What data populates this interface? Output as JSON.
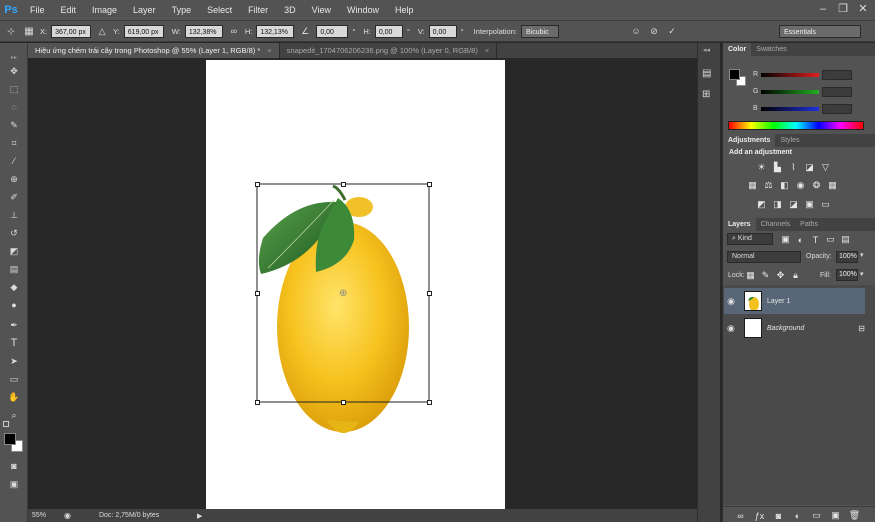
{
  "app": {
    "logo": "Ps"
  },
  "menu": [
    "File",
    "Edit",
    "Image",
    "Layer",
    "Type",
    "Select",
    "Filter",
    "3D",
    "View",
    "Window",
    "Help"
  ],
  "window_controls": {
    "minimize": "–",
    "restore": "❐",
    "close": "✕"
  },
  "options": {
    "x_label": "X:",
    "x_value": "367,00 px",
    "y_label": "Y:",
    "y_value": "619,00 px",
    "w_label": "W:",
    "w_value": "132,38%",
    "h_label": "H:",
    "h_value": "132,13%",
    "angle_value": "0,00",
    "degree": "°",
    "hskew_label": "H:",
    "hskew_value": "0,00",
    "vskew_label": "V:",
    "vskew_value": "0,00",
    "interp_label": "Interpolation:",
    "interp_value": "Bicubic",
    "workspace": "Essentials"
  },
  "tabs": [
    {
      "label": "Hiệu ứng chém trái cây trong Photoshop @ 55% (Layer 1, RGB/8) *",
      "close": "×",
      "active": true
    },
    {
      "label": "snapedit_1704706206236.png @ 100% (Layer 0, RGB/8)",
      "close": "×",
      "active": false
    }
  ],
  "status": {
    "zoom": "55%",
    "doc": "Doc: 2,75M/0 bytes",
    "arrow": "▶"
  },
  "color_panel": {
    "tabs": [
      "Color",
      "Swatches"
    ],
    "channels": [
      {
        "label": "R",
        "value": "0",
        "color": "#d22020"
      },
      {
        "label": "G",
        "value": "0",
        "color": "#1fa01f"
      },
      {
        "label": "B",
        "value": "0",
        "color": "#2030d0"
      }
    ]
  },
  "adjustments_panel": {
    "tabs": [
      "Adjustments",
      "Styles"
    ],
    "heading": "Add an adjustment"
  },
  "layers_panel": {
    "tabs": [
      "Layers",
      "Channels",
      "Paths"
    ],
    "kind": "Kind",
    "blend_mode": "Normal",
    "opacity_label": "Opacity:",
    "opacity_value": "100%",
    "lock_label": "Lock:",
    "fill_label": "Fill:",
    "fill_value": "100%",
    "layers": [
      {
        "name": "Layer 1",
        "selected": true
      },
      {
        "name": "Background",
        "selected": false
      }
    ]
  },
  "colors": {
    "ui_bg": "#535353",
    "canvas_bg": "#282828",
    "selection": "#596678",
    "accent": "#31a8ff"
  }
}
